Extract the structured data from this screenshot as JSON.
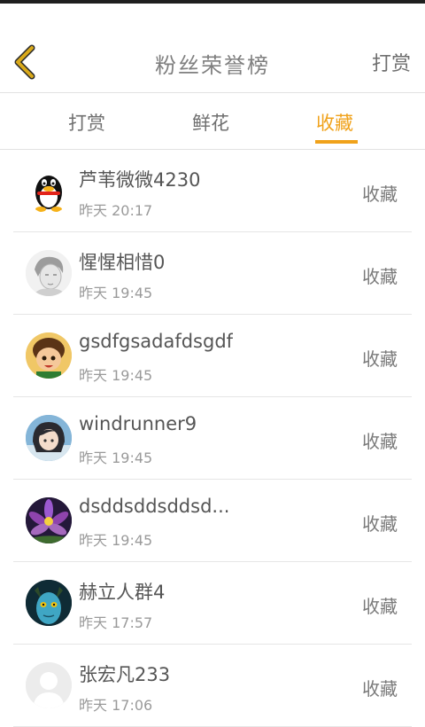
{
  "header": {
    "title": "粉丝荣誉榜",
    "action_label": "打赏"
  },
  "tabs": [
    {
      "label": "打赏",
      "active": false
    },
    {
      "label": "鲜花",
      "active": false
    },
    {
      "label": "收藏",
      "active": true
    }
  ],
  "colors": {
    "accent": "#f0a21b",
    "back_icon": "#d9a91a"
  },
  "list": [
    {
      "name": "芦苇微微4230",
      "time": "昨天 20:17",
      "action": "收藏",
      "avatar": "penguin-avatar"
    },
    {
      "name": "惺惺相惜0",
      "time": "昨天 19:45",
      "action": "收藏",
      "avatar": "sketch-avatar"
    },
    {
      "name": "gsdfgsadafdsgdf",
      "time": "昨天 19:45",
      "action": "收藏",
      "avatar": "cartoon-boy-avatar"
    },
    {
      "name": "windrunner9",
      "time": "昨天 19:45",
      "action": "收藏",
      "avatar": "anime-girl-avatar"
    },
    {
      "name": "dsddsddsddsd...",
      "time": "昨天 19:45",
      "action": "收藏",
      "avatar": "purple-flower-avatar"
    },
    {
      "name": "赫立人群4",
      "time": "昨天 17:57",
      "action": "收藏",
      "avatar": "blue-creature-avatar"
    },
    {
      "name": "张宏凡233",
      "time": "昨天 17:06",
      "action": "收藏",
      "avatar": "default-avatar"
    }
  ]
}
